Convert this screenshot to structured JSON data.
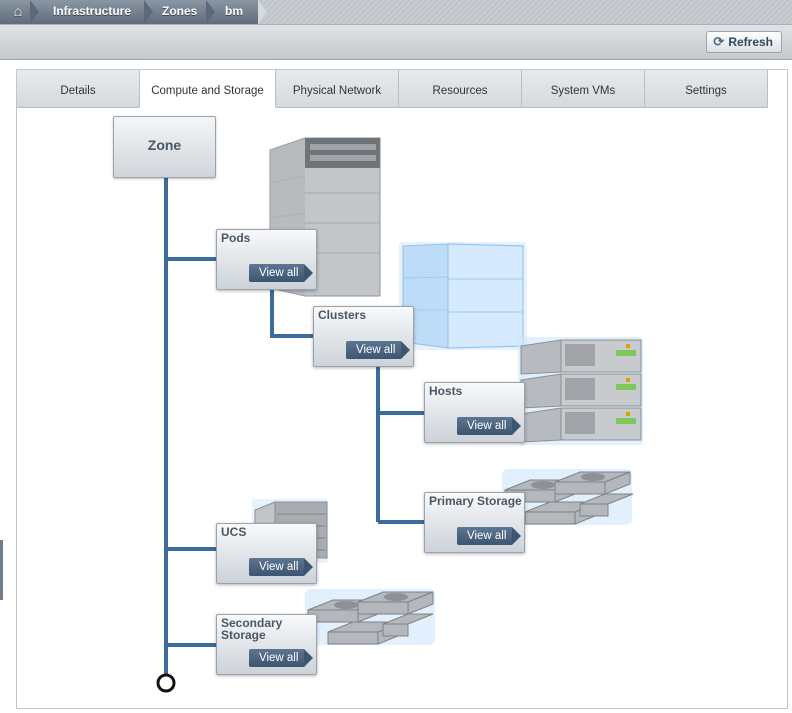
{
  "breadcrumb": {
    "home_icon": "home-icon",
    "items": [
      "Infrastructure",
      "Zones",
      "bm"
    ]
  },
  "toolbar": {
    "refresh_label": "Refresh",
    "refresh_icon": "refresh-icon"
  },
  "tabs": [
    {
      "label": "Details",
      "active": false
    },
    {
      "label": "Compute and Storage",
      "active": true
    },
    {
      "label": "Physical Network",
      "active": false
    },
    {
      "label": "Resources",
      "active": false
    },
    {
      "label": "System VMs",
      "active": false
    },
    {
      "label": "Settings",
      "active": false
    }
  ],
  "diagram": {
    "zone_label": "Zone",
    "nodes": {
      "pods": {
        "title": "Pods",
        "action": "View all",
        "icon": "rack-icon"
      },
      "clusters": {
        "title": "Clusters",
        "action": "View all",
        "icon": "cluster-cube-icon"
      },
      "hosts": {
        "title": "Hosts",
        "action": "View all",
        "icon": "host-servers-icon"
      },
      "primary_storage": {
        "title": "Primary Storage",
        "action": "View all",
        "icon": "disk-drives-icon"
      },
      "ucs": {
        "title": "UCS",
        "action": "View all",
        "icon": "ucs-chassis-icon"
      },
      "secondary_storage": {
        "title": "Secondary Storage",
        "action": "View all",
        "icon": "disk-drives-icon"
      }
    },
    "colors": {
      "connector": "#3a6d9b",
      "button": "#4a6380",
      "glow": "#9cc8f0"
    }
  }
}
